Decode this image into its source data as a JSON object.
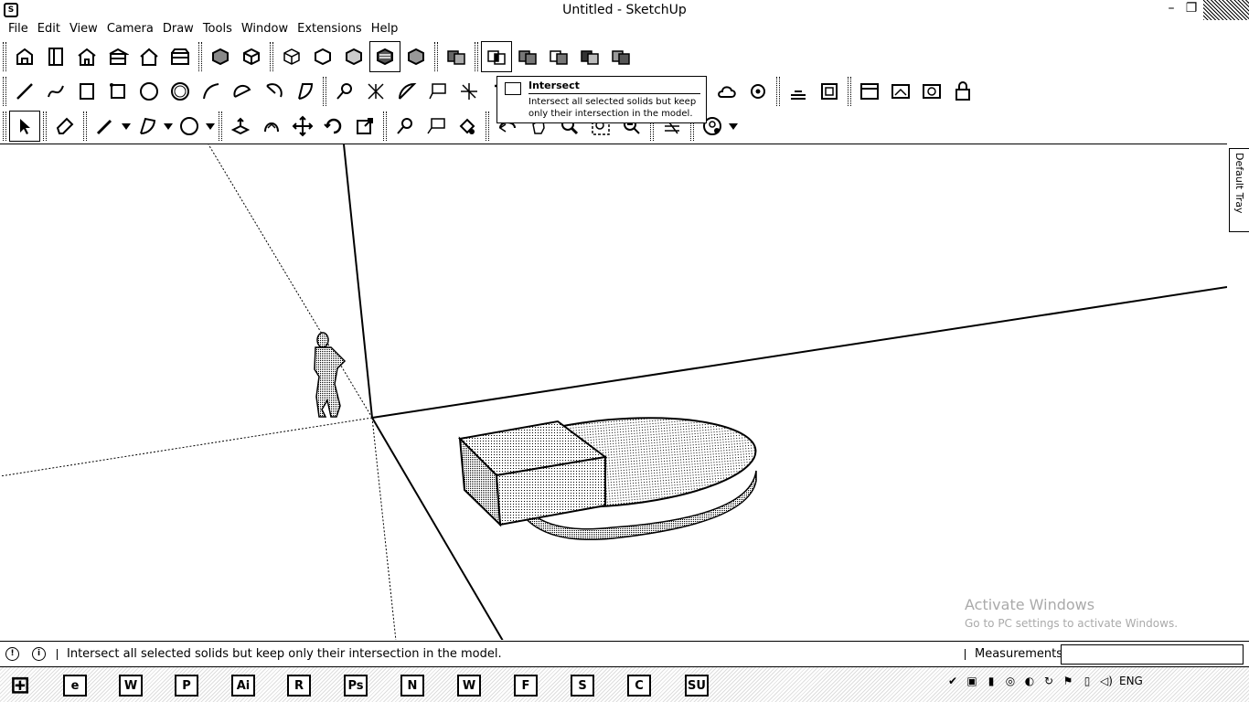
{
  "window": {
    "title": "Untitled - SketchUp",
    "app_icon": "sketchup-logo-icon",
    "min_glyph": "–",
    "restore_glyph": "❐"
  },
  "menu": [
    "File",
    "Edit",
    "View",
    "Camera",
    "Draw",
    "Tools",
    "Window",
    "Extensions",
    "Help"
  ],
  "toolbars": {
    "row1": [
      "iso-view-icon",
      "top-view-icon",
      "front-view-icon",
      "right-view-icon",
      "back-view-icon",
      "left-view-icon",
      "xray-icon",
      "back-edges-icon",
      "wireframe-icon",
      "hidden-line-icon",
      "shaded-icon",
      "shaded-textures-icon",
      "monochrome-icon",
      "outer-shell-icon",
      "intersect-icon",
      "union-icon",
      "subtract-icon",
      "trim-icon",
      "split-icon"
    ],
    "row2": [
      "line-icon",
      "freehand-icon",
      "rectangle-icon",
      "rotated-rectangle-icon",
      "circle-icon",
      "polygon-icon",
      "arc-icon",
      "2pt-arc-icon",
      "3pt-arc-icon",
      "pie-icon",
      "tape-measure-icon",
      "dimension-icon",
      "protractor-icon",
      "text-icon",
      "axes-icon",
      "3d-text-icon",
      "position-camera-icon",
      "look-around-icon",
      "walk-icon",
      "sandbox-icon",
      "warehouse-icon",
      "extension-warehouse-icon",
      "layout-icon",
      "share-model-icon",
      "section-plane-icon",
      "display-section-icon",
      "photo-match-icon",
      "new-match-photo-icon",
      "lock-icon"
    ],
    "row3": [
      "select-icon",
      "eraser-icon",
      "pencil-icon",
      "arc-tool-icon",
      "shape-tool-icon",
      "push-pull-icon",
      "follow-me-icon",
      "move-icon",
      "rotate-icon",
      "scale-icon",
      "tape-icon",
      "text-label-icon",
      "paint-bucket-icon",
      "orbit-icon",
      "pan-icon",
      "zoom-icon",
      "zoom-window-icon",
      "zoom-extents-icon",
      "previous-icon",
      "next-icon",
      "section-icon",
      "user-icon"
    ]
  },
  "tooltip": {
    "title": "Intersect",
    "description": "Intersect all selected solids but keep only their intersection in the model."
  },
  "tray": {
    "label": "Default Tray"
  },
  "watermark": {
    "line1": "Activate Windows",
    "line2": "Go to PC settings to activate Windows."
  },
  "status": {
    "text": "Intersect all selected solids but keep only their intersection in the model.",
    "measurements_label": "Measurements",
    "measurements_value": ""
  },
  "taskbar": {
    "items": [
      {
        "name": "start-button",
        "glyph": "⊞"
      },
      {
        "name": "edge-icon",
        "glyph": "e"
      },
      {
        "name": "word-pad-icon",
        "glyph": "W"
      },
      {
        "name": "printer-icon",
        "glyph": "P"
      },
      {
        "name": "illustrator-icon",
        "glyph": "Ai"
      },
      {
        "name": "reader-icon",
        "glyph": "R"
      },
      {
        "name": "ps-icon",
        "glyph": "Ps"
      },
      {
        "name": "news-icon",
        "glyph": "N"
      },
      {
        "name": "word-icon",
        "glyph": "W"
      },
      {
        "name": "firefox-icon",
        "glyph": "F"
      },
      {
        "name": "skype-icon",
        "glyph": "S"
      },
      {
        "name": "chrome-icon",
        "glyph": "C"
      },
      {
        "name": "sketchup-taskbar-icon",
        "glyph": "SU"
      }
    ],
    "tray_icons": [
      "✔",
      "▣",
      "▮",
      "◎",
      "◐",
      "↻",
      "⚑",
      "▯",
      "◁)",
      "ENG"
    ],
    "clock_time": "",
    "clock_date": ""
  },
  "colors": {
    "background": "#ffffff",
    "foreground": "#000000",
    "watermark": "#aaaaaa"
  }
}
